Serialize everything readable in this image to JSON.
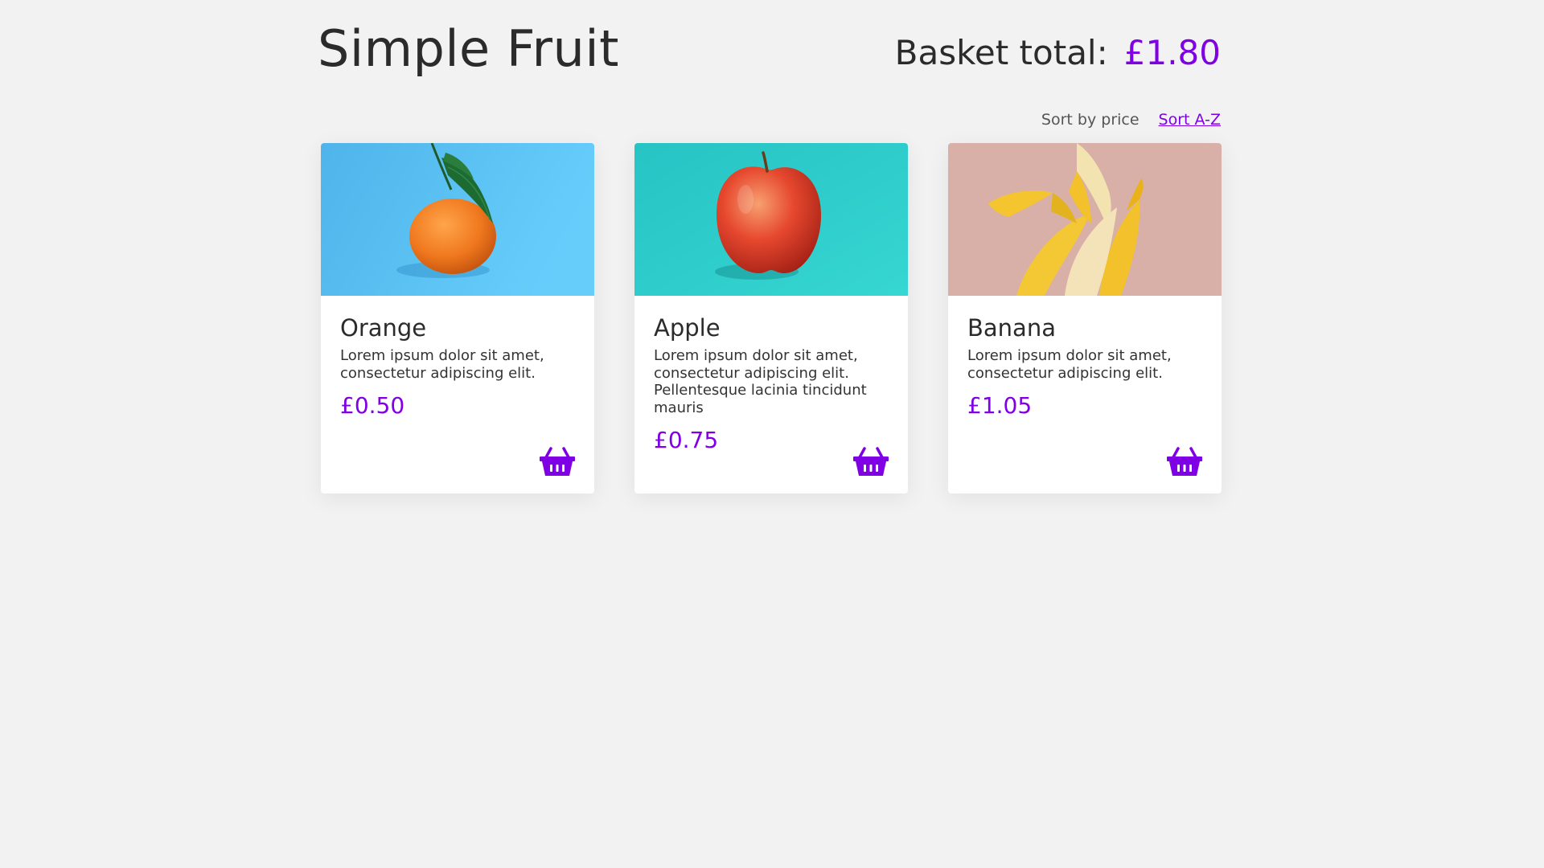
{
  "header": {
    "title": "Simple Fruit",
    "basket_label": "Basket total:",
    "basket_total": "£1.80"
  },
  "sort": {
    "by_price_label": "Sort by price",
    "az_label": "Sort A-Z",
    "active": "az"
  },
  "products": [
    {
      "name": "Orange",
      "description": "Lorem ipsum dolor sit amet, consectetur adipiscing elit.",
      "price": "£0.50",
      "image_icon": "orange-photo",
      "add_icon": "basket-icon"
    },
    {
      "name": "Apple",
      "description": "Lorem ipsum dolor sit amet, consectetur adipiscing elit. Pellentesque lacinia tincidunt mauris",
      "price": "£0.75",
      "image_icon": "apple-photo",
      "add_icon": "basket-icon"
    },
    {
      "name": "Banana",
      "description": "Lorem ipsum dolor sit amet, consectetur adipiscing elit.",
      "price": "£1.05",
      "image_icon": "banana-photo",
      "add_icon": "basket-icon"
    }
  ],
  "colors": {
    "accent": "#8000e6",
    "background": "#f2f2f2",
    "text": "#2b2b2b",
    "orange_bg": "#5ec3f5",
    "apple_bg": "#2ecfcf",
    "banana_bg": "#d8b0a8"
  }
}
